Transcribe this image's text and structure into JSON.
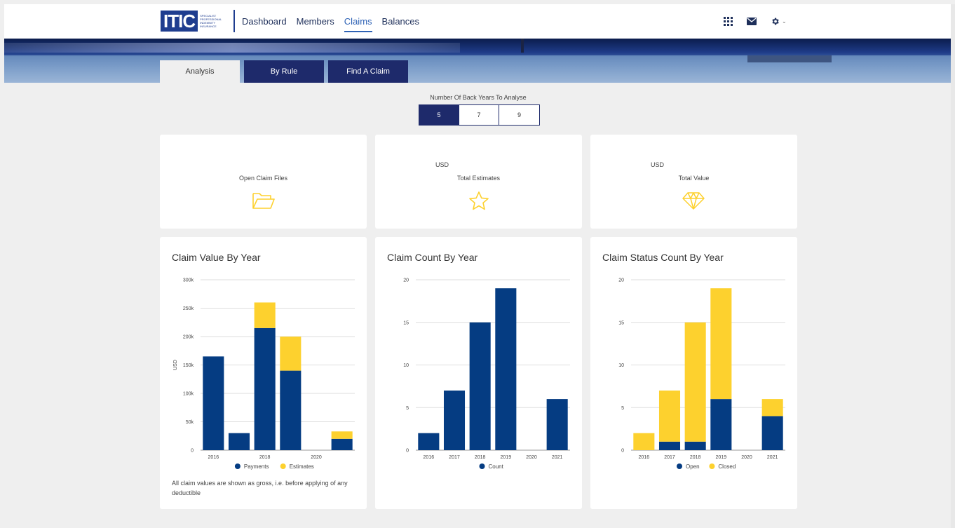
{
  "logo": {
    "text": "ITIC",
    "sub": "SPECIALIST PROFESSIONAL INDEMNITY INSURANCE"
  },
  "nav": [
    "Dashboard",
    "Members",
    "Claims",
    "Balances"
  ],
  "nav_active": "Claims",
  "top_icons": [
    "apps-grid-icon",
    "mail-icon",
    "gear-icon"
  ],
  "tabs": [
    "Analysis",
    "By Rule",
    "Find A Claim"
  ],
  "tab_active": "Analysis",
  "years": {
    "label": "Number Of Back Years To Analyse",
    "options": [
      "5",
      "7",
      "9"
    ],
    "selected": "5"
  },
  "stats": {
    "open_claims": {
      "label": "Open Claim Files"
    },
    "estimates": {
      "currency": "USD",
      "label": "Total Estimates"
    },
    "value": {
      "currency": "USD",
      "label": "Total Value"
    }
  },
  "colors": {
    "navy": "#053c82",
    "yellow": "#fdd12e",
    "nav_dark": "#1e2a6b"
  },
  "chart_data": [
    {
      "type": "bar",
      "title": "Claim Value By Year",
      "ylabel": "USD",
      "categories": [
        "2016",
        "2017",
        "2018",
        "2019",
        "2020",
        "2021"
      ],
      "xtick_labels": [
        "2016",
        "",
        "2018",
        "",
        "2020",
        ""
      ],
      "yticks": [
        "0",
        "50k",
        "100k",
        "150k",
        "200k",
        "250k",
        "300k"
      ],
      "ylim": [
        0,
        300000
      ],
      "stacked": true,
      "series": [
        {
          "name": "Payments",
          "color": "#053c82",
          "values": [
            165000,
            30000,
            215000,
            140000,
            0,
            20000
          ]
        },
        {
          "name": "Estimates",
          "color": "#fdd12e",
          "values": [
            0,
            0,
            45000,
            60000,
            0,
            13000
          ]
        }
      ],
      "footnote": "All claim values are shown as gross, i.e. before applying of any deductible"
    },
    {
      "type": "bar",
      "title": "Claim Count By Year",
      "categories": [
        "2016",
        "2017",
        "2018",
        "2019",
        "2020",
        "2021"
      ],
      "xtick_labels": [
        "2016",
        "2017",
        "2018",
        "2019",
        "2020",
        "2021"
      ],
      "yticks": [
        "0",
        "5",
        "10",
        "15",
        "20"
      ],
      "ylim": [
        0,
        20
      ],
      "stacked": true,
      "series": [
        {
          "name": "Count",
          "color": "#053c82",
          "values": [
            2,
            7,
            15,
            19,
            0,
            6
          ]
        }
      ]
    },
    {
      "type": "bar",
      "title": "Claim Status Count By Year",
      "categories": [
        "2016",
        "2017",
        "2018",
        "2019",
        "2020",
        "2021"
      ],
      "xtick_labels": [
        "2016",
        "2017",
        "2018",
        "2019",
        "2020",
        "2021"
      ],
      "yticks": [
        "0",
        "5",
        "10",
        "15",
        "20"
      ],
      "ylim": [
        0,
        20
      ],
      "stacked": true,
      "series": [
        {
          "name": "Open",
          "color": "#053c82",
          "values": [
            0,
            1,
            1,
            6,
            0,
            4
          ]
        },
        {
          "name": "Closed",
          "color": "#fdd12e",
          "values": [
            2,
            6,
            14,
            13,
            0,
            2
          ]
        }
      ]
    }
  ]
}
